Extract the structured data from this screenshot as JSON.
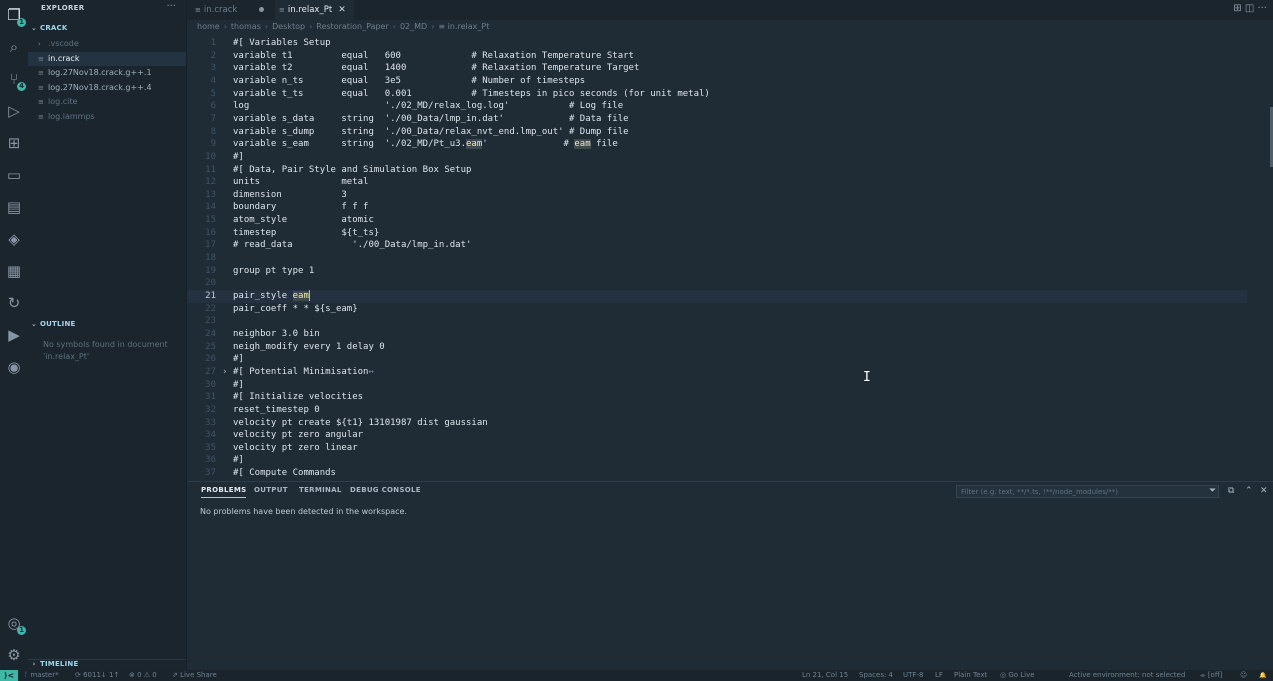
{
  "activity_bar": {
    "badges": {
      "explorer": "1",
      "source_control": "4",
      "accounts": "1"
    }
  },
  "sidebar": {
    "title": "EXPLORER",
    "more": "···",
    "folder": "CRACK",
    "files": [
      {
        "name": ".vscode",
        "kind": "folder",
        "state": "dim"
      },
      {
        "name": "in.crack",
        "kind": "file",
        "state": "active"
      },
      {
        "name": "log.27Nov18.crack.g++.1",
        "kind": "file",
        "state": "norm"
      },
      {
        "name": "log.27Nov18.crack.g++.4",
        "kind": "file",
        "state": "norm"
      },
      {
        "name": "log.cite",
        "kind": "file",
        "state": "dim"
      },
      {
        "name": "log.lammps",
        "kind": "file",
        "state": "dim"
      }
    ],
    "outline": {
      "title": "OUTLINE",
      "message": "No symbols found in document 'in.relax_Pt'"
    },
    "timeline": {
      "title": "TIMELINE"
    }
  },
  "tabs": [
    {
      "label": "in.crack",
      "active": false
    },
    {
      "label": "in.relax_Pt",
      "active": true
    }
  ],
  "tab_actions": "⊞ ◫ ···",
  "breadcrumb": [
    "home",
    "thomas",
    "Desktop",
    "Restoration_Paper",
    "02_MD",
    "in.relax_Pt"
  ],
  "editor": {
    "current_line": 21,
    "lines": [
      {
        "n": "1",
        "text": "#[ Variables Setup"
      },
      {
        "n": "2",
        "text": "variable t1         equal   600             # Relaxation Temperature Start"
      },
      {
        "n": "3",
        "text": "variable t2         equal   1400            # Relaxation Temperature Target"
      },
      {
        "n": "4",
        "text": "variable n_ts       equal   3e5             # Number of timesteps"
      },
      {
        "n": "5",
        "text": "variable t_ts       equal   0.001           # Timesteps in pico seconds (for unit metal)"
      },
      {
        "n": "6",
        "text": "log                         './02_MD/relax_log.log'           # Log file"
      },
      {
        "n": "7",
        "text": "variable s_data     string  './00_Data/lmp_in.dat'            # Data file"
      },
      {
        "n": "8",
        "text": "variable s_dump     string  './00_Data/relax_nvt_end.lmp_out' # Dump file"
      },
      {
        "n": "9",
        "pre": "variable s_eam      string  './02_MD/Pt_u3.",
        "hl": "eam",
        "mid": "'              # ",
        "hl2": "eam",
        "post": " file"
      },
      {
        "n": "10",
        "text": "#]"
      },
      {
        "n": "11",
        "text": "#[ Data, Pair Style and Simulation Box Setup"
      },
      {
        "n": "12",
        "text": "units               metal"
      },
      {
        "n": "13",
        "text": "dimension           3"
      },
      {
        "n": "14",
        "text": "boundary            f f f"
      },
      {
        "n": "15",
        "text": "atom_style          atomic"
      },
      {
        "n": "16",
        "text": "timestep            ${t_ts}"
      },
      {
        "n": "17",
        "text": "# read_data           './00_Data/lmp_in.dat'"
      },
      {
        "n": "18",
        "text": ""
      },
      {
        "n": "19",
        "text": "group pt type 1"
      },
      {
        "n": "20",
        "text": ""
      },
      {
        "n": "21",
        "pre": "pair_style ",
        "hl": "eam",
        "caret": true
      },
      {
        "n": "22",
        "text": "pair_coeff * * ${s_eam}"
      },
      {
        "n": "23",
        "text": ""
      },
      {
        "n": "24",
        "text": "neighbor 3.0 bin"
      },
      {
        "n": "25",
        "text": "neigh_modify every 1 delay 0"
      },
      {
        "n": "26",
        "text": "#]"
      },
      {
        "n": "27",
        "text": "#[ Potential Minimisation",
        "fold": true,
        "ellipsis": "↔"
      },
      {
        "n": "30",
        "text": "#]"
      },
      {
        "n": "31",
        "text": "#[ Initialize velocities"
      },
      {
        "n": "32",
        "text": "reset_timestep 0"
      },
      {
        "n": "33",
        "text": "velocity pt create ${t1} 13101987 dist gaussian"
      },
      {
        "n": "34",
        "text": "velocity pt zero angular"
      },
      {
        "n": "35",
        "text": "velocity pt zero linear"
      },
      {
        "n": "36",
        "text": "#]"
      },
      {
        "n": "37",
        "text": "#[ Compute Commands"
      }
    ]
  },
  "panel": {
    "tabs": [
      "PROBLEMS",
      "OUTPUT",
      "TERMINAL",
      "DEBUG CONSOLE"
    ],
    "active_tab": "PROBLEMS",
    "filter_placeholder": "Filter (e.g. text, **/*.ts, !**/node_modules/**)",
    "message": "No problems have been detected in the workspace."
  },
  "status": {
    "remote": "⟩<",
    "branch": "ᚴ master*",
    "sync": "⟳ 6011↓ 1↑",
    "problems": "⊗ 0 ⚠ 0",
    "live_share": "⇗ Live Share",
    "position": "Ln 21, Col 15",
    "spaces": "Spaces: 4",
    "encoding": "UTF-8",
    "eol": "LF",
    "language": "Plain Text",
    "go_live": "◎ Go Live",
    "env": "Active environment: not selected",
    "off": "⌯ [off]",
    "feedback": "☺",
    "bell": "🔔"
  }
}
